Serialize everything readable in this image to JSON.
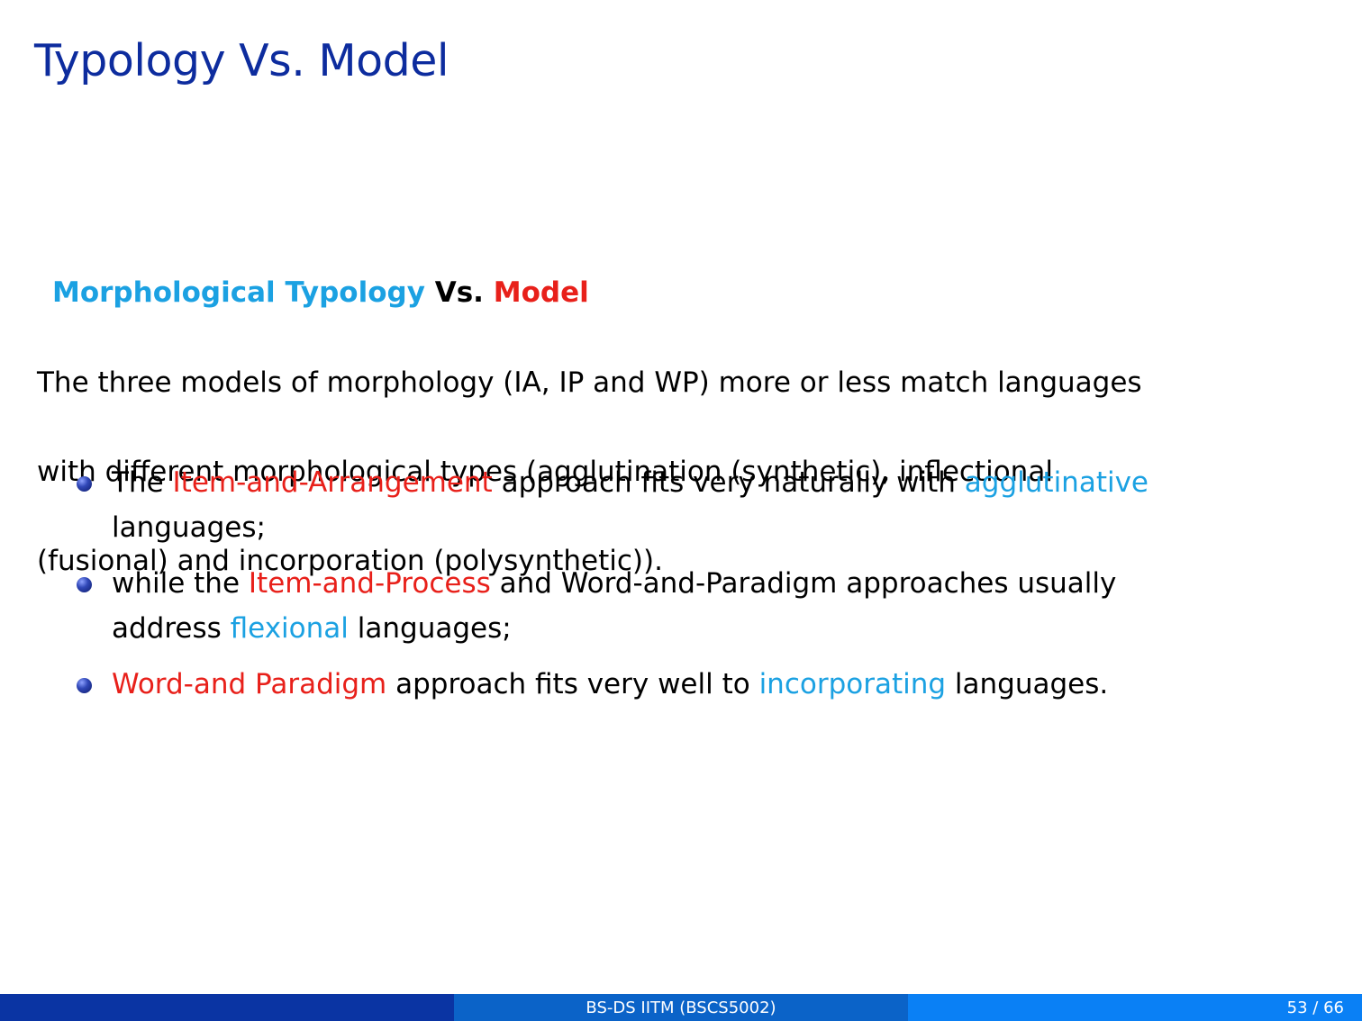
{
  "slide": {
    "title": "Typology Vs. Model"
  },
  "block": {
    "heading_part1": "Morphological Typology",
    "heading_part2": "Vs.",
    "heading_part3": "Model",
    "paragraph_lines": [
      "The three models of morphology (IA, IP and WP) more or less match languages",
      "with different morphological types (agglutination (synthetic), inflectional",
      "(fusional) and incorporation (polysynthetic))."
    ]
  },
  "bullets": [
    {
      "line1_prefix": "The ",
      "line1_red": "Item-and-Arrangement",
      "line1_middle": " approach fits very naturally with ",
      "line1_blue": "agglutinative",
      "line2": "languages;"
    },
    {
      "line1_prefix": "while the ",
      "line1_red": "Item-and-Process",
      "line1_suffix": " and Word-and-Paradigm approaches usually",
      "line2_prefix": "address ",
      "line2_blue": "flexional",
      "line2_suffix": " languages;"
    },
    {
      "line1_red": "Word-and Paradigm",
      "line1_middle": " approach fits very well to ",
      "line1_blue": "incorporating",
      "line1_suffix": " languages."
    }
  ],
  "footer": {
    "center_text": "BS-DS IITM (BSCS5002)",
    "page_number": "53 / 66"
  },
  "colors": {
    "title": "#0d2c9e",
    "highlight_blue": "#1ba1e2",
    "highlight_red": "#e8201a",
    "footer_left": "#0a34a3",
    "footer_center": "#0b63c8",
    "footer_right": "#0a80f5"
  }
}
